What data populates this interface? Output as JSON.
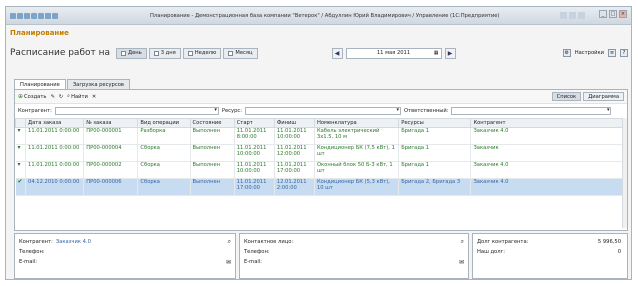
{
  "window": {
    "title": "Планирование - Демонстрационная база компании \"Ветерок\" / Абдуллин Юрий Владимирович / Управление (1С:Предприятие)"
  },
  "section_title": "Планирование",
  "schedule": {
    "label": "Расписание работ на",
    "periods": [
      "День",
      "3 дня",
      "Неделю",
      "Месяц"
    ],
    "date": "11 мая 2011",
    "settings_label": "Настройки"
  },
  "tabs": [
    "Планирование",
    "Загрузка ресурсов"
  ],
  "toolbar": {
    "create_label": "Создать",
    "find_label": "Найти",
    "list_label": "Список",
    "diagram_label": "Диаграмма"
  },
  "filters": {
    "contragent_label": "Контрагент:",
    "resource_label": "Ресурс:",
    "responsible_label": "Ответственный:"
  },
  "table": {
    "columns": [
      "Дата заказа",
      "№ заказа",
      "Вид операции",
      "Состояние",
      "Старт",
      "Финиш",
      "Номенклатура",
      "Ресурсы",
      "Контрагент"
    ],
    "rows": [
      {
        "date": "11.01.2011 0:00:00",
        "num": "ПР00-000001",
        "op": "Разборка",
        "state": "Выполнен",
        "start": "11.01.2011 8:00:00",
        "finish": "11.01.2011 10:00:00",
        "nom": "Кабель электрический 3х1.5, 10 м",
        "res": "Бригада 1",
        "client": "Заказчик 4.0"
      },
      {
        "date": "11.01.2011 0:00:00",
        "num": "ПР00-000004",
        "op": "Сборка",
        "state": "Выполнен",
        "start": "11.01.2011 10:00:00",
        "finish": "11.01.2011 12:00:00",
        "nom": "Кондиционер БК (7,5 кВт), 1 шт",
        "res": "Бригада 1",
        "client": "Заказчик"
      },
      {
        "date": "11.01.2011 0:00:00",
        "num": "ПР00-000002",
        "op": "Сборка",
        "state": "Выполнен",
        "start": "11.01.2011 10:00:00",
        "finish": "11.01.2011 17:00:00",
        "nom": "Оконный блок 50 Б-3 кВт, 1 шт",
        "res": "Бригада 1",
        "client": "Заказчик 4.0"
      },
      {
        "date": "04.12.2010 0:00:00",
        "num": "ПР00-000006",
        "op": "Сборка",
        "state": "Выполнен",
        "start": "11.01.2011 17:00:00",
        "finish": "12.01.2011 2:00:00",
        "nom": "Кондиционер БК (5,3 кВт), 10 шт",
        "res": "Бригада 2, Бригада 3",
        "client": "Заказчик 4.0"
      }
    ]
  },
  "bottom": {
    "contragent_label": "Контрагент:",
    "contragent_value": "Заказчик 4.0",
    "phone_label": "Телефон:",
    "email_label": "E-mail:",
    "contact_label": "Контактное лицо:",
    "debt_label": "Долг контрагента:",
    "debt_value": "5 996,50",
    "our_debt_label": "Наш долг:",
    "our_debt_value": "0"
  }
}
